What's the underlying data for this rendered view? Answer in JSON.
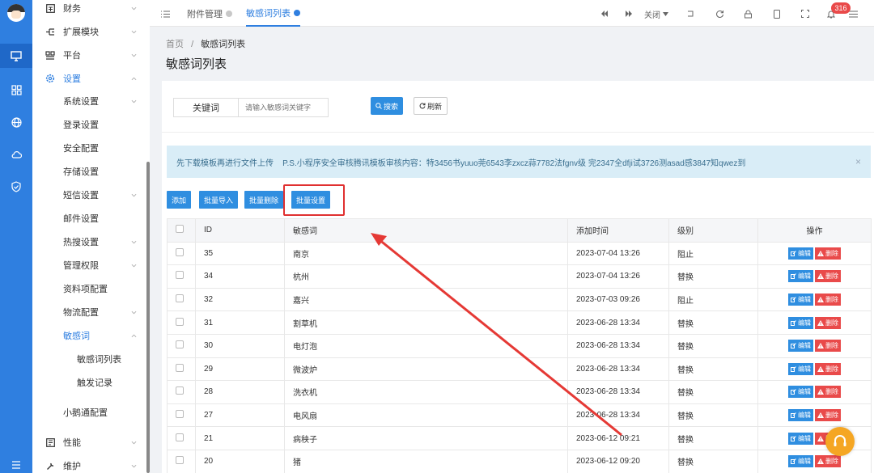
{
  "rail": {
    "icons": [
      "avatar",
      "monitor-icon",
      "grid-icon",
      "globe-icon",
      "cloud-icon",
      "shield-check-icon",
      "menu-icon"
    ]
  },
  "sidebar": {
    "items": [
      {
        "label": "财务",
        "icon": "finance-icon",
        "chevron": "down",
        "level": 0
      },
      {
        "label": "扩展模块",
        "icon": "module-icon",
        "chevron": "down",
        "level": 0
      },
      {
        "label": "平台",
        "icon": "platform-icon",
        "chevron": "down",
        "level": 0
      },
      {
        "label": "设置",
        "icon": "gear-icon",
        "chevron": "up",
        "level": 0,
        "active": true
      },
      {
        "label": "系统设置",
        "chevron": "down",
        "level": 1
      },
      {
        "label": "登录设置",
        "level": 1
      },
      {
        "label": "安全配置",
        "level": 1
      },
      {
        "label": "存储设置",
        "level": 1
      },
      {
        "label": "短信设置",
        "chevron": "down",
        "level": 1
      },
      {
        "label": "邮件设置",
        "level": 1
      },
      {
        "label": "热搜设置",
        "chevron": "down",
        "level": 1
      },
      {
        "label": "管理权限",
        "chevron": "down",
        "level": 1
      },
      {
        "label": "资料项配置",
        "level": 1
      },
      {
        "label": "物流配置",
        "chevron": "down",
        "level": 1
      },
      {
        "label": "敏感词",
        "chevron": "up",
        "level": 1,
        "active": true
      },
      {
        "label": "敏感词列表",
        "level": 2
      },
      {
        "label": "触发记录",
        "level": 2
      },
      {
        "label": "小鹅通配置",
        "level": 1
      },
      {
        "label": "性能",
        "icon": "performance-icon",
        "chevron": "down",
        "level": 0
      },
      {
        "label": "维护",
        "icon": "wrench-icon",
        "chevron": "down",
        "level": 0
      }
    ]
  },
  "topbar": {
    "tabs": [
      {
        "label": "附件管理",
        "active": false
      },
      {
        "label": "敏感词列表",
        "active": true
      }
    ],
    "close_label": "关闭",
    "notification_count": "316"
  },
  "breadcrumb": {
    "home": "首页",
    "sep": "/",
    "current": "敏感词列表"
  },
  "page_title": "敏感词列表",
  "search": {
    "key_label": "关键词",
    "placeholder": "请输入敏感词关键字",
    "search_label": "搜索",
    "refresh_label": "刷新"
  },
  "alert": {
    "text": "先下载模板再进行文件上传    P.S.小程序安全审核腾讯模板审核内容：特3456书yuuo莞6543李zxcz蒜7782法fgnv级 完2347全dfji试3726测asad感3847知qwez到",
    "close": "×"
  },
  "actions": {
    "add": "添加",
    "import": "批量导入",
    "delete": "批量删除",
    "settings": "批量设置"
  },
  "table": {
    "headers": [
      "ID",
      "敏感词",
      "添加时间",
      "级别",
      "操作"
    ],
    "edit_label": "编辑",
    "delete_label": "删除",
    "rows": [
      {
        "id": "35",
        "word": "南京",
        "time": "2023-07-04 13:26",
        "level": "阻止"
      },
      {
        "id": "34",
        "word": "杭州",
        "time": "2023-07-04 13:26",
        "level": "替换"
      },
      {
        "id": "32",
        "word": "嘉兴",
        "time": "2023-07-03 09:26",
        "level": "阻止"
      },
      {
        "id": "31",
        "word": "割草机",
        "time": "2023-06-28 13:34",
        "level": "替换"
      },
      {
        "id": "30",
        "word": "电灯泡",
        "time": "2023-06-28 13:34",
        "level": "替换"
      },
      {
        "id": "29",
        "word": "微波炉",
        "time": "2023-06-28 13:34",
        "level": "替换"
      },
      {
        "id": "28",
        "word": "洗衣机",
        "time": "2023-06-28 13:34",
        "level": "替换"
      },
      {
        "id": "27",
        "word": "电风扇",
        "time": "2023-06-28 13:34",
        "level": "替换"
      },
      {
        "id": "21",
        "word": "病秧子",
        "time": "2023-06-12 09:21",
        "level": "替换"
      },
      {
        "id": "20",
        "word": "猪",
        "time": "2023-06-12 09:20",
        "level": "替换"
      }
    ]
  },
  "colors": {
    "accent": "#2f7fe0",
    "danger": "#e94a4a",
    "highlight": "#e03030",
    "help": "#f5a623"
  }
}
